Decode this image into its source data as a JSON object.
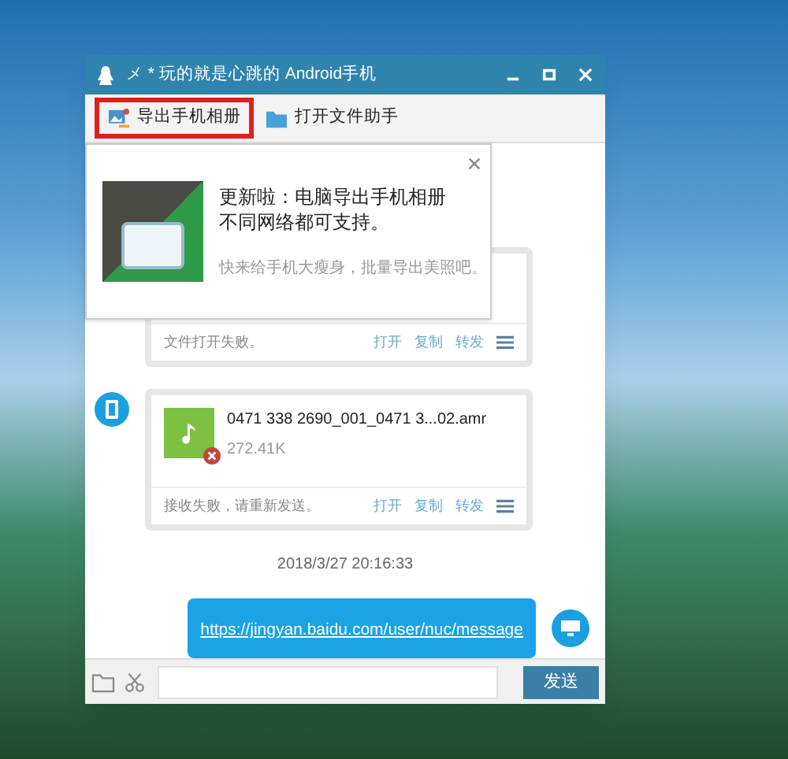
{
  "window": {
    "title": "メ * 玩的就是心跳的 Android手机"
  },
  "toolbar": [
    {
      "label": "导出手机相册",
      "highlighted": true
    },
    {
      "label": "打开文件助手",
      "highlighted": false
    }
  ],
  "popup": {
    "headline": "更新啦：电脑导出手机相册不同网络都可支持。",
    "subtext": "快来给手机大瘦身，批量导出美照吧。"
  },
  "messages": [
    {
      "kind": "file",
      "show_file": false,
      "status": "文件打开失败。",
      "actions": [
        "打开",
        "复制",
        "转发"
      ]
    },
    {
      "kind": "file",
      "show_file": true,
      "file_name": "0471 338 2690_001_0471 3...02.amr",
      "size": "272.41K",
      "status": "接收失败，请重新发送。",
      "actions": [
        "打开",
        "复制",
        "转发"
      ]
    },
    {
      "kind": "time",
      "text": "2018/3/27 20:16:33"
    },
    {
      "kind": "link",
      "text": "https://jingyan.baidu.com/user/nuc/message"
    }
  ],
  "send_button": "发送"
}
